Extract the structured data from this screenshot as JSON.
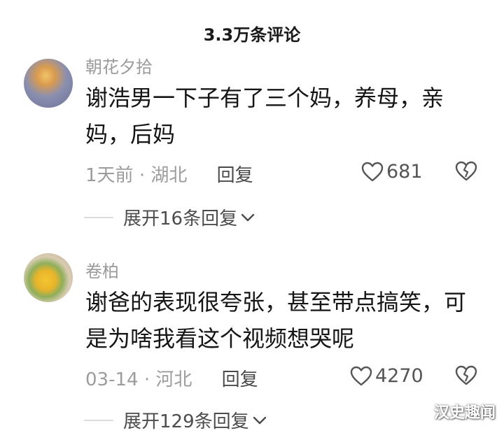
{
  "header": {
    "title": "3.3万条评论"
  },
  "comments": [
    {
      "username": "朝花夕拾",
      "text": "谢浩男一下子有了三个妈，养母，亲妈，后妈",
      "time": "1天前",
      "location": "湖北",
      "reply_label": "回复",
      "likes": "681",
      "expand_label": "展开16条回复"
    },
    {
      "username": "卷柏",
      "text": "谢爸的表现很夸张，甚至带点搞笑，可是为啥我看这个视频想哭呢",
      "time": "03-14",
      "location": "河北",
      "reply_label": "回复",
      "likes": "4270",
      "expand_label": "展开129条回复"
    }
  ],
  "watermark": "汉史趣闻",
  "separator": "·"
}
